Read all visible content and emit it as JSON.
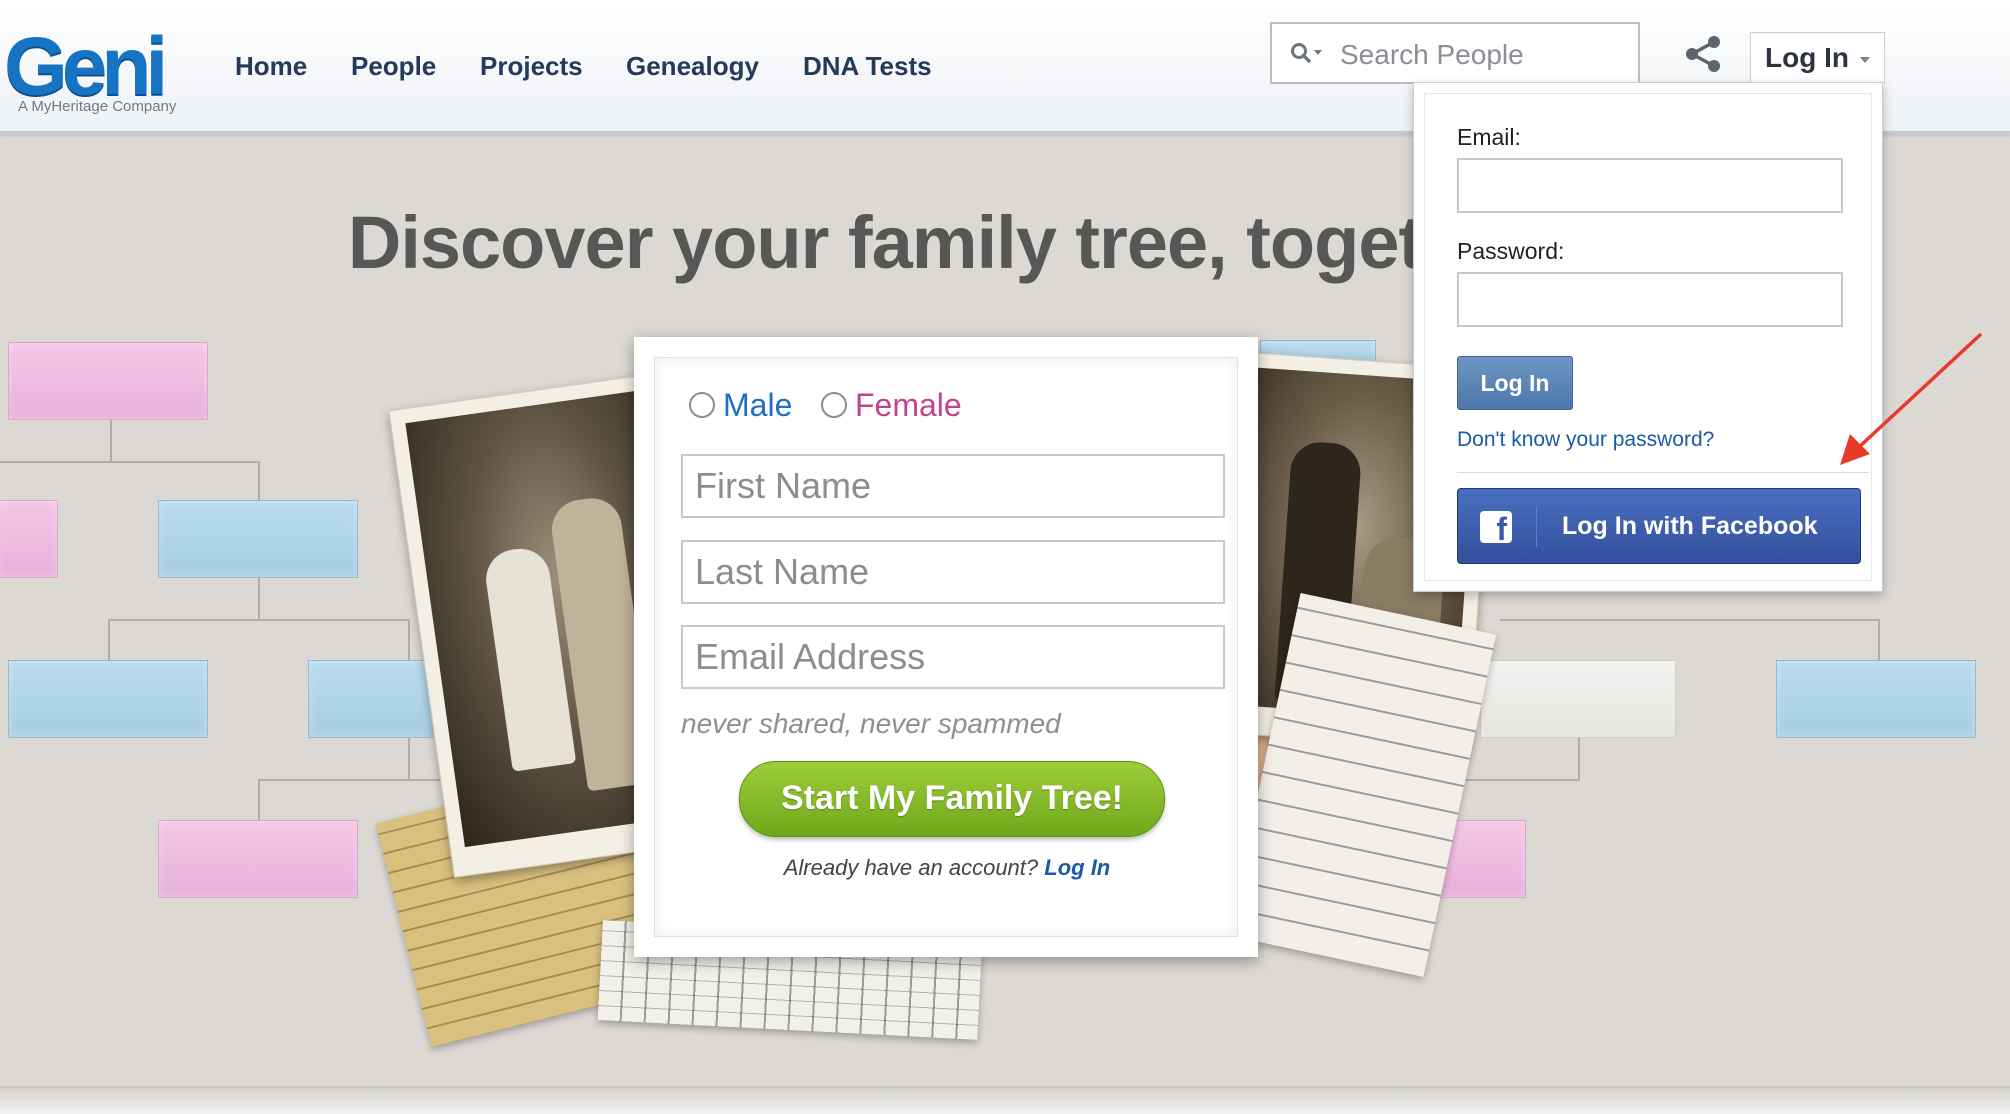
{
  "header": {
    "logo": {
      "text": "Geni",
      "tagline": "A MyHeritage Company"
    },
    "nav": [
      "Home",
      "People",
      "Projects",
      "Genealogy",
      "DNA Tests"
    ],
    "search": {
      "placeholder": "Search People",
      "icon": "search-icon"
    },
    "share_icon": "share-icon",
    "login_label": "Log In"
  },
  "hero": {
    "title": "Discover your family tree, toget"
  },
  "signup": {
    "gender_options": [
      "Male",
      "Female"
    ],
    "first_name_placeholder": "First Name",
    "last_name_placeholder": "Last Name",
    "email_placeholder": "Email Address",
    "email_hint": "never shared, never spammed",
    "submit_label": "Start My Family Tree!",
    "already_text": "Already have an account?",
    "login_link": "Log In"
  },
  "login_dropdown": {
    "email_label": "Email:",
    "password_label": "Password:",
    "submit_label": "Log In",
    "forgot_link": "Don't know your password?",
    "facebook_label": "Log In with Facebook"
  },
  "colors": {
    "brand_blue": "#1774c4",
    "nav_text": "#233a5c",
    "male": "#1f6fc2",
    "female": "#c2448c",
    "start_button": "#7fb52a",
    "facebook": "#3b5998",
    "annotation_arrow": "#e8392b"
  }
}
